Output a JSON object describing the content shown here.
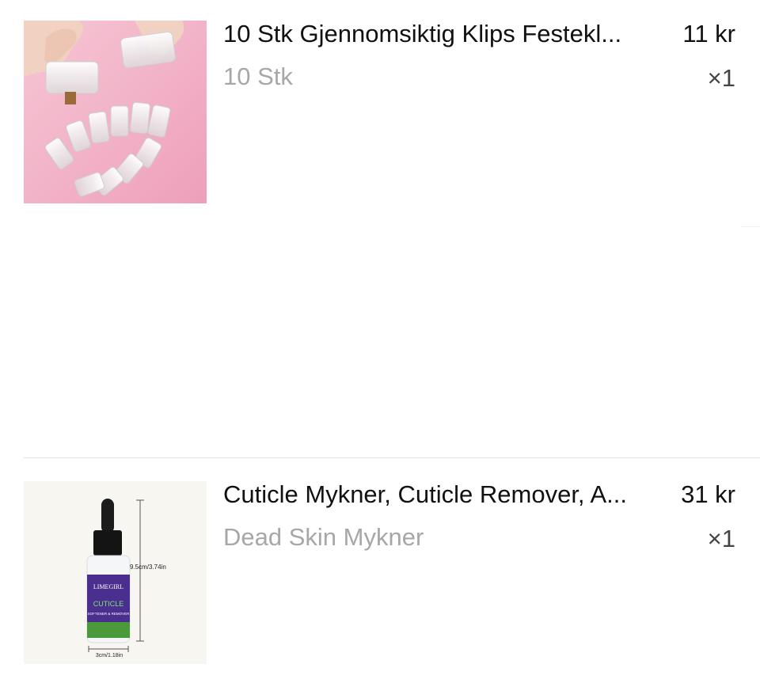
{
  "cart": {
    "items": [
      {
        "title": "10 Stk Gjennomsiktig Klips Festekl...",
        "variant": "10 Stk",
        "price": "11 kr",
        "quantity": "×1",
        "image_icon": "nail-clips-product-image"
      },
      {
        "title": "Cuticle Mykner, Cuticle Remover, A...",
        "variant": "Dead Skin Mykner",
        "price": "31 kr",
        "quantity": "×1",
        "image_icon": "cuticle-bottle-product-image",
        "image_text": {
          "brand": "LIMEGIRL",
          "product": "CUTICLE",
          "subtitle": "SOFTENER & REMOVER",
          "height_label": "9.5cm/3.74in",
          "width_label": "3cm/1.18in"
        }
      }
    ]
  },
  "colors": {
    "pink_background": "#f2bfcf",
    "bottle_purple": "#4b2f8f",
    "bottle_label_green": "#4a9a3c",
    "secondary_text": "#a7a7a7"
  }
}
